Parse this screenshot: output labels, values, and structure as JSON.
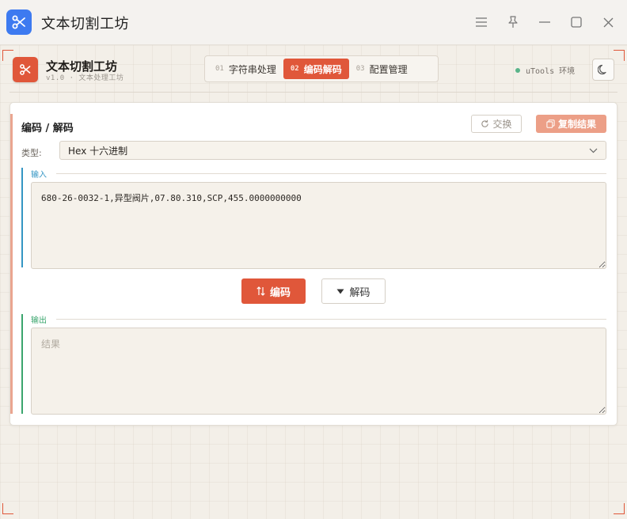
{
  "window": {
    "title": "文本切割工坊",
    "accent": "#3d7af0"
  },
  "header": {
    "brand_name": "文本切割工坊",
    "brand_sub": "v1.0 · 文本处理工坊",
    "env_label": "uTools 环境",
    "tabs": [
      {
        "num": "01",
        "label": "字符串处理",
        "active": false
      },
      {
        "num": "02",
        "label": "编码解码",
        "active": true
      },
      {
        "num": "03",
        "label": "配置管理",
        "active": false
      }
    ]
  },
  "card": {
    "title": "编码 / 解码",
    "swap_label": "交换",
    "copy_label": "复制结果",
    "type_label": "类型:",
    "type_value": "Hex 十六进制",
    "input_label": "输入",
    "input_value": "680-26-0032-1,异型阀片,07.80.310,SCP,455.0000000000",
    "encode_label": "编码",
    "decode_label": "解码",
    "output_label": "输出",
    "output_placeholder": "结果"
  },
  "colors": {
    "brand": "#e0573a",
    "input_accent": "#3496c4",
    "output_accent": "#3aa56d",
    "env_status": "#5ab48a"
  },
  "icons": [
    "scissors-icon",
    "menu-icon",
    "pin-icon",
    "minimize-icon",
    "maximize-icon",
    "close-icon",
    "moon-icon",
    "refresh-icon",
    "copy-icon",
    "swap-arrows-icon",
    "caret-down-icon",
    "chevron-down-icon"
  ]
}
